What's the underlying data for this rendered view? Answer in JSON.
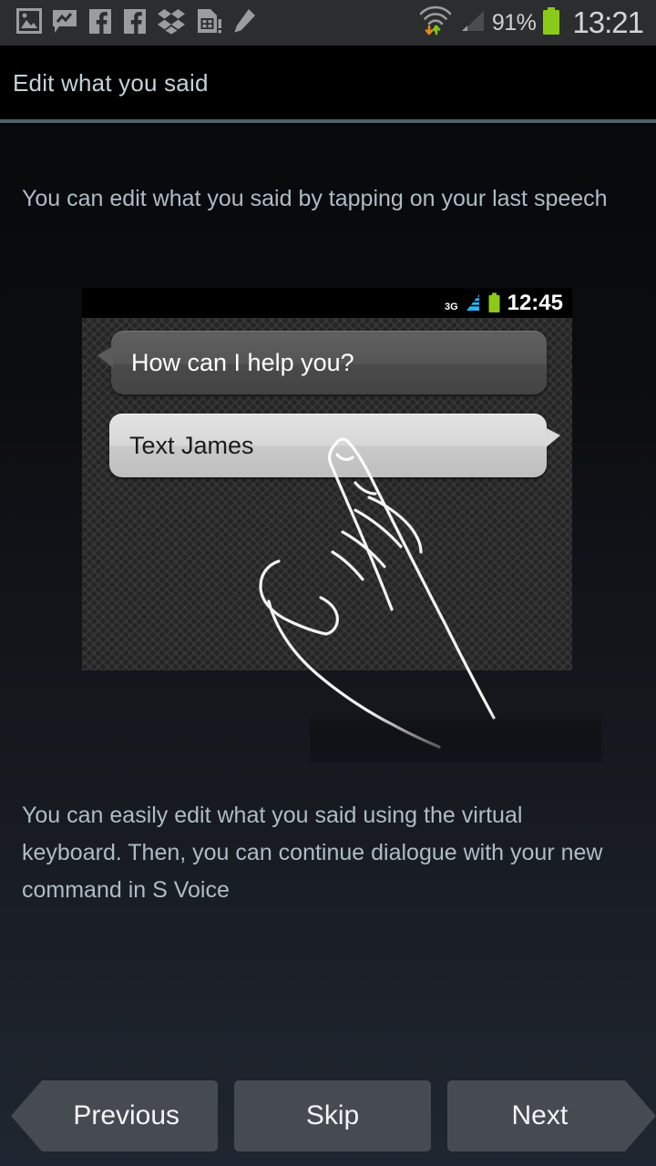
{
  "status_bar": {
    "battery_percent": "91%",
    "clock": "13:21",
    "notification_icons": [
      "gallery-image-icon",
      "messenger-icon",
      "facebook-icon",
      "facebook-icon",
      "dropbox-icon",
      "sim-card-alert-icon",
      "pencil-edit-icon"
    ],
    "right_icons": [
      "wifi-data-transfer-icon",
      "cellular-signal-icon",
      "battery-icon"
    ],
    "battery_color": "#8bc919",
    "text_color": "#cfd2d3",
    "background": "#2b2d2e"
  },
  "title_bar": {
    "title": "Edit what you said",
    "divider_color": "#4e6068"
  },
  "main": {
    "description_top": "You can edit what you said by tapping on your last speech",
    "description_bottom": "You can easily edit what you said using the virtual keyboard. Then, you can continue dialogue with your new command in S Voice",
    "text_color": "#aebcc6"
  },
  "illustration": {
    "inner_status_bar": {
      "network_label": "3G",
      "clock": "12:45",
      "signal_color": "#29b6f6",
      "battery_color": "#8bc919"
    },
    "bubbles": [
      {
        "name": "assistant-bubble",
        "text": "How can I help you?",
        "tail": "left",
        "style": "dark"
      },
      {
        "name": "user-bubble",
        "text": "Text James",
        "tail": "right",
        "style": "light"
      }
    ],
    "gesture": "tap-hand-icon"
  },
  "footer": {
    "buttons": [
      {
        "name": "previous-button",
        "label": "Previous",
        "shape": "left-chevron"
      },
      {
        "name": "skip-button",
        "label": "Skip",
        "shape": "rectangle"
      },
      {
        "name": "next-button",
        "label": "Next",
        "shape": "right-chevron"
      }
    ],
    "button_color": "#464b52",
    "button_text_color": "#f2f4f6"
  }
}
